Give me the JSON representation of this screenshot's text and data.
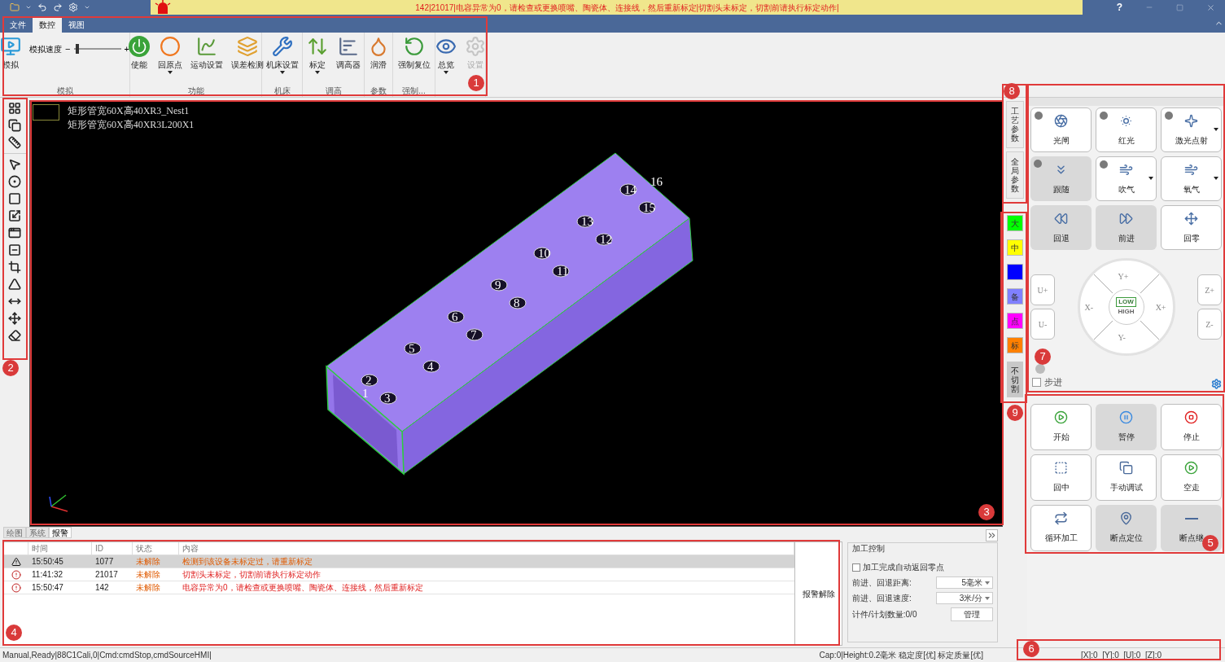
{
  "title_bar": {
    "alert_text": "142|21017|电容异常为0，请检查或更换喷嘴、陶瓷体、连接线，然后重新标定|切割头未标定，切割前请执行标定动作|",
    "help": "?"
  },
  "ribbon_tabs": [
    {
      "label": "文件",
      "selected": false
    },
    {
      "label": "数控",
      "selected": true
    },
    {
      "label": "视图",
      "selected": false
    }
  ],
  "ribbon_groups": [
    {
      "label": "模拟",
      "items": [
        {
          "kind": "button",
          "label": "模拟",
          "dropdown": false,
          "disabled": false
        },
        {
          "kind": "slider",
          "label": "模拟速度",
          "minus": "−",
          "plus": "+",
          "level": 0.05
        }
      ]
    },
    {
      "label": "功能",
      "items": [
        {
          "kind": "button",
          "label": "使能",
          "dropdown": false,
          "disabled": false
        },
        {
          "kind": "button",
          "label": "回原点",
          "dropdown": true,
          "disabled": false
        },
        {
          "kind": "button",
          "label": "运动设置",
          "dropdown": false,
          "disabled": false
        },
        {
          "kind": "button",
          "label": "误差检测",
          "dropdown": false,
          "disabled": false
        }
      ]
    },
    {
      "label": "机床",
      "items": [
        {
          "kind": "button",
          "label": "机床设置",
          "dropdown": true,
          "disabled": false
        }
      ]
    },
    {
      "label": "调高",
      "items": [
        {
          "kind": "button",
          "label": "标定",
          "dropdown": true,
          "disabled": false
        },
        {
          "kind": "button",
          "label": "调高器",
          "dropdown": false,
          "disabled": false
        }
      ]
    },
    {
      "label": "参数",
      "items": [
        {
          "kind": "button",
          "label": "润滑",
          "dropdown": false,
          "disabled": false
        }
      ]
    },
    {
      "label": "强制...",
      "items": [
        {
          "kind": "button",
          "label": "强制复位",
          "dropdown": false,
          "disabled": false
        }
      ]
    },
    {
      "items": [
        {
          "kind": "button",
          "label": "总览",
          "dropdown": true,
          "disabled": false
        },
        {
          "kind": "button",
          "label": "设置",
          "dropdown": false,
          "disabled": true
        }
      ]
    }
  ],
  "canvas": {
    "part_labels": [
      "矩形管宽60X高40XR3_Nest1",
      "矩形管宽60X高40XR3L200X1"
    ],
    "hole_numbers": [
      "1",
      "2",
      "3",
      "4",
      "5",
      "6",
      "7",
      "8",
      "9",
      "10",
      "11",
      "12",
      "13",
      "14",
      "15",
      "16"
    ]
  },
  "side_tabs": [
    {
      "label": "工艺参数",
      "selected": false
    },
    {
      "label": "全局参数",
      "selected": false
    }
  ],
  "layers": [
    {
      "label": "大",
      "color": "#00ff00"
    },
    {
      "label": "中",
      "color": "#ffff00"
    },
    {
      "color": "#0000ff"
    },
    {
      "label": "备",
      "color": "#8080ff"
    },
    {
      "label": "点",
      "color": "#ff00ff"
    },
    {
      "label": "标",
      "color": "#ff8000"
    }
  ],
  "no_cut": "不切割",
  "log": {
    "tabs": [
      {
        "label": "绘图",
        "selected": false
      },
      {
        "label": "系统",
        "selected": false
      },
      {
        "label": "报警",
        "selected": true
      }
    ],
    "columns": [
      "时间",
      "ID",
      "状态",
      "内容"
    ],
    "rows": [
      {
        "kind": "warning",
        "selected": true,
        "time": "15:50:45",
        "id": "1077",
        "status": "未解除",
        "content": "检测到该设备未标定过，请重新标定"
      },
      {
        "kind": "error",
        "selected": false,
        "time": "11:41:32",
        "id": "21017",
        "status": "未解除",
        "content": "切割头未标定，切割前请执行标定动作"
      },
      {
        "kind": "error",
        "selected": false,
        "time": "15:50:47",
        "id": "142",
        "status": "未解除",
        "content": "电容异常为0，请检查或更换喷嘴、陶瓷体、连接线，然后重新标定"
      }
    ],
    "clear_button": "报警解除"
  },
  "process_control": {
    "title": "加工控制",
    "auto_return": {
      "label": "加工完成自动返回零点",
      "checked": false
    },
    "fields": [
      {
        "label": "前进、回退距离:",
        "value": "5毫米"
      },
      {
        "label": "前进、回退速度:",
        "value": "3米/分"
      }
    ],
    "count": "计件/计划数量:0/0",
    "manage": "管理"
  },
  "laser_buttons": [
    {
      "kind": "lamp",
      "on": false,
      "label": "光闸",
      "dropdown": false,
      "disabled": false
    },
    {
      "kind": "lamp",
      "on": false,
      "label": "红光",
      "dropdown": false,
      "disabled": false
    },
    {
      "kind": "lamp",
      "on": false,
      "label": "激光点射",
      "dropdown": true,
      "disabled": false
    },
    {
      "kind": "lamp",
      "on": false,
      "label": "跟随",
      "dropdown": false,
      "disabled": true
    },
    {
      "kind": "lamp",
      "on": false,
      "label": "吹气",
      "dropdown": true,
      "disabled": false
    },
    {
      "kind": "plain",
      "label": "氧气",
      "dropdown": true,
      "disabled": false
    },
    {
      "kind": "plain",
      "label": "回退",
      "dropdown": false,
      "disabled": true
    },
    {
      "kind": "plain",
      "label": "前进",
      "dropdown": false,
      "disabled": true
    },
    {
      "kind": "plain",
      "label": "回零",
      "dropdown": false,
      "disabled": false
    }
  ],
  "axis_buttons": [
    "U+",
    "U-",
    "Z+",
    "Z-"
  ],
  "wheel_directions": [
    "Y+",
    "X-",
    "X+",
    "Y-"
  ],
  "speed_modes": [
    {
      "label": "LOW",
      "selected": true
    },
    {
      "label": "HIGH",
      "selected": false
    }
  ],
  "step": {
    "label": "步进",
    "checked": false
  },
  "run_buttons": [
    {
      "label": "开始",
      "disabled": false
    },
    {
      "label": "暂停",
      "disabled": true
    },
    {
      "label": "停止",
      "disabled": false
    },
    {
      "label": "回中",
      "disabled": false
    },
    {
      "label": "手动调试",
      "disabled": false
    },
    {
      "label": "空走",
      "disabled": false
    },
    {
      "label": "循环加工",
      "disabled": false
    },
    {
      "label": "断点定位",
      "disabled": true
    },
    {
      "label": "断点继",
      "disabled": true
    }
  ],
  "status_bar": {
    "left": "Manual,Ready|88C1Cali,0|Cmd:cmdStop,cmdSourceHMI|",
    "middle": "Cap:0|Height:0.2毫米 稳定度[优] 标定质量[优]",
    "coords": "[X]:0  [Y]:0  [U]:0  [Z]:0"
  },
  "callouts": [
    "1",
    "2",
    "3",
    "4",
    "5",
    "6",
    "7",
    "8",
    "9"
  ]
}
